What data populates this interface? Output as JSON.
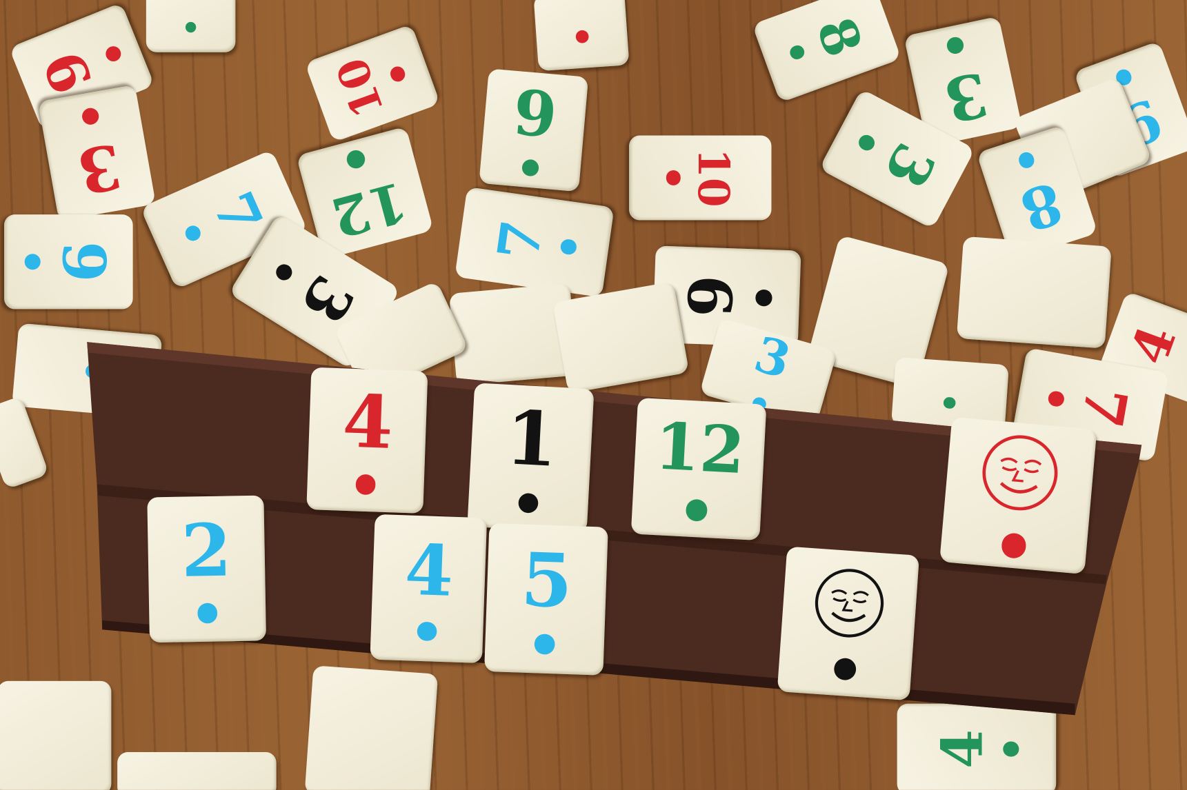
{
  "colors": {
    "red": "#d9262c",
    "black": "#121212",
    "green": "#23955c",
    "blue": "#2db6ea",
    "rack": "#4b2a20",
    "tile": "#f3efdc"
  },
  "scattered_tiles": [
    {
      "number": "9",
      "color": "red"
    },
    {
      "number": "",
      "color": "green"
    },
    {
      "number": "10",
      "color": "red"
    },
    {
      "number": "",
      "color": "red"
    },
    {
      "number": "8",
      "color": "green"
    },
    {
      "number": "3",
      "color": "green"
    },
    {
      "number": "9",
      "color": "blue"
    },
    {
      "number": "",
      "color": "blank"
    },
    {
      "number": "3",
      "color": "green"
    },
    {
      "number": "8",
      "color": "blue"
    },
    {
      "number": "3",
      "color": "red"
    },
    {
      "number": "9",
      "color": "green"
    },
    {
      "number": "10",
      "color": "red"
    },
    {
      "number": "12",
      "color": "green"
    },
    {
      "number": "7",
      "color": "blue"
    },
    {
      "number": "9",
      "color": "blue"
    },
    {
      "number": "7",
      "color": "blue"
    },
    {
      "number": "3",
      "color": "black"
    },
    {
      "number": "9",
      "color": "black"
    },
    {
      "number": "",
      "color": "blank"
    },
    {
      "number": "",
      "color": "blank"
    },
    {
      "number": "",
      "color": "blank"
    },
    {
      "number": "",
      "color": "blank"
    },
    {
      "number": "",
      "color": "blank"
    },
    {
      "number": "3",
      "color": "blue"
    },
    {
      "number": "4",
      "color": "red"
    },
    {
      "number": "7",
      "color": "red"
    },
    {
      "number": "",
      "color": "green"
    },
    {
      "number": "",
      "color": "blue"
    },
    {
      "number": "",
      "color": "blank"
    },
    {
      "number": "",
      "color": "blank"
    },
    {
      "number": "",
      "color": "blank"
    },
    {
      "number": "4",
      "color": "green"
    },
    {
      "number": "",
      "color": "blank"
    }
  ],
  "rack_tiles": [
    {
      "number": "4",
      "color": "red"
    },
    {
      "number": "1",
      "color": "black"
    },
    {
      "number": "12",
      "color": "green"
    },
    {
      "number": "joker",
      "color": "red"
    },
    {
      "number": "2",
      "color": "blue"
    },
    {
      "number": "4",
      "color": "blue"
    },
    {
      "number": "5",
      "color": "blue"
    },
    {
      "number": "joker",
      "color": "black"
    }
  ]
}
